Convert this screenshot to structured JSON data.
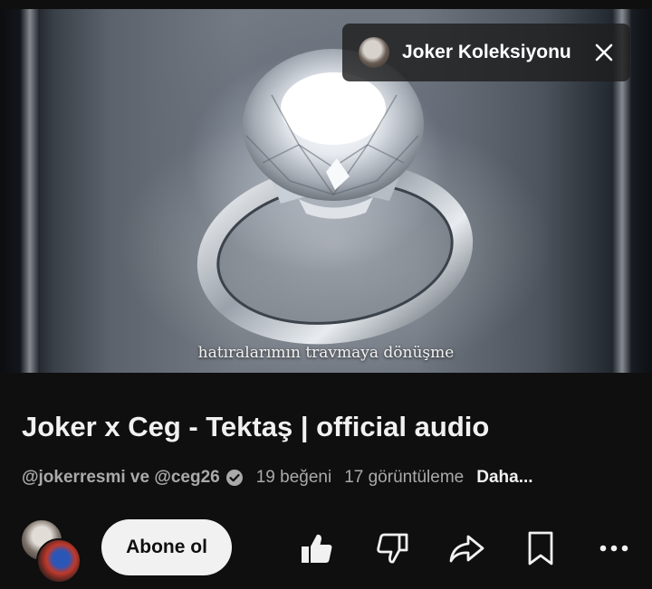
{
  "player": {
    "subtitle": "hatıralarımın travmaya dönüşme",
    "progress": 0.03
  },
  "playlist": {
    "title": "Joker Koleksiyonu",
    "close_icon": "close-icon"
  },
  "video": {
    "title": "Joker x Ceg - Tektaş | official audio",
    "authors": "@jokerresmi ve @ceg26",
    "likes": "19 beğeni",
    "views": "17 görüntüleme",
    "more_label": "Daha..."
  },
  "actions": {
    "subscribe_label": "Abone ol",
    "icons": [
      "like-icon",
      "dislike-icon",
      "share-icon",
      "save-icon",
      "more-vert-icon"
    ]
  },
  "colors": {
    "background": "#0f0f0f",
    "text": "#f1f1f1",
    "secondary_text": "#aaaaaa",
    "progress": "#ff0000"
  }
}
